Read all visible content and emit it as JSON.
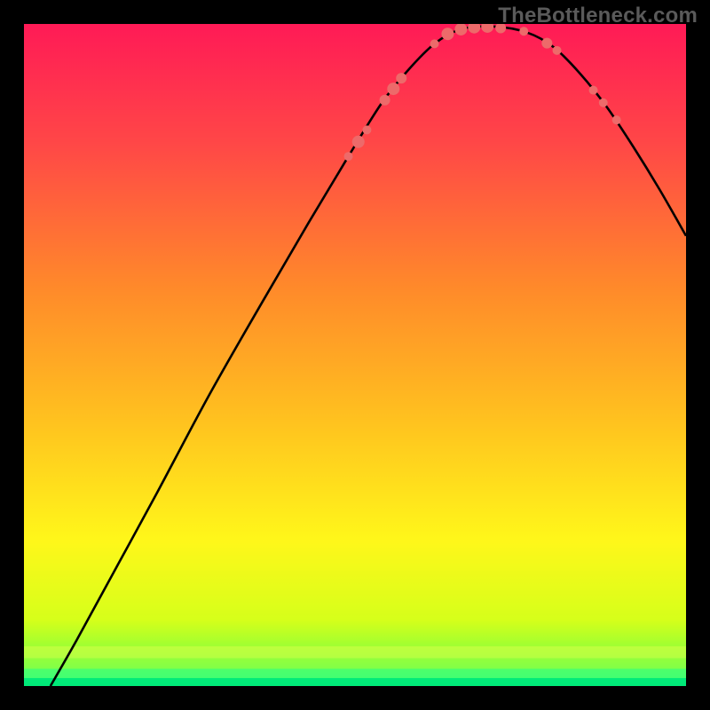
{
  "watermark": "TheBottleneck.com",
  "chart_data": {
    "type": "line",
    "title": "",
    "xlabel": "",
    "ylabel": "",
    "xrange": [
      0,
      100
    ],
    "yrange": [
      0,
      100
    ],
    "gradient_stops": [
      {
        "offset": 0,
        "color": "#ff1a56"
      },
      {
        "offset": 0.18,
        "color": "#ff4747"
      },
      {
        "offset": 0.4,
        "color": "#ff8a2a"
      },
      {
        "offset": 0.6,
        "color": "#ffc21f"
      },
      {
        "offset": 0.78,
        "color": "#fff71a"
      },
      {
        "offset": 0.9,
        "color": "#d6ff1a"
      },
      {
        "offset": 0.955,
        "color": "#8bff3a"
      },
      {
        "offset": 0.985,
        "color": "#2bff7a"
      },
      {
        "offset": 1.0,
        "color": "#00e676"
      }
    ],
    "green_bands": [
      {
        "y": 94.0,
        "color": "#d8ff47",
        "opacity": 0.55,
        "h": 1.8
      },
      {
        "y": 95.8,
        "color": "#9dff3a",
        "opacity": 0.65,
        "h": 1.6
      },
      {
        "y": 97.4,
        "color": "#4cff6e",
        "opacity": 0.8,
        "h": 1.4
      },
      {
        "y": 98.8,
        "color": "#00e978",
        "opacity": 0.95,
        "h": 1.2
      }
    ],
    "curve": [
      {
        "x": 4.0,
        "y": 0.0
      },
      {
        "x": 8.0,
        "y": 7.0
      },
      {
        "x": 14.0,
        "y": 18.0
      },
      {
        "x": 20.0,
        "y": 29.0
      },
      {
        "x": 28.0,
        "y": 44.0
      },
      {
        "x": 36.0,
        "y": 58.0
      },
      {
        "x": 43.0,
        "y": 70.0
      },
      {
        "x": 49.0,
        "y": 80.0
      },
      {
        "x": 54.0,
        "y": 88.0
      },
      {
        "x": 58.0,
        "y": 93.0
      },
      {
        "x": 62.0,
        "y": 97.0
      },
      {
        "x": 66.0,
        "y": 99.2
      },
      {
        "x": 71.0,
        "y": 99.6
      },
      {
        "x": 76.0,
        "y": 98.7
      },
      {
        "x": 80.0,
        "y": 96.5
      },
      {
        "x": 84.0,
        "y": 92.5
      },
      {
        "x": 88.0,
        "y": 87.5
      },
      {
        "x": 92.0,
        "y": 81.5
      },
      {
        "x": 96.0,
        "y": 75.0
      },
      {
        "x": 100.0,
        "y": 68.0
      }
    ],
    "dots": [
      {
        "x": 49.0,
        "y": 80.0,
        "r": 5
      },
      {
        "x": 50.5,
        "y": 82.2,
        "r": 7
      },
      {
        "x": 51.8,
        "y": 84.0,
        "r": 5
      },
      {
        "x": 54.5,
        "y": 88.5,
        "r": 6
      },
      {
        "x": 55.8,
        "y": 90.2,
        "r": 7
      },
      {
        "x": 57.0,
        "y": 91.8,
        "r": 6
      },
      {
        "x": 62.0,
        "y": 97.0,
        "r": 5
      },
      {
        "x": 64.0,
        "y": 98.5,
        "r": 7
      },
      {
        "x": 66.0,
        "y": 99.2,
        "r": 7
      },
      {
        "x": 68.0,
        "y": 99.5,
        "r": 7
      },
      {
        "x": 70.0,
        "y": 99.6,
        "r": 7
      },
      {
        "x": 72.0,
        "y": 99.4,
        "r": 6
      },
      {
        "x": 75.5,
        "y": 98.9,
        "r": 5
      },
      {
        "x": 79.0,
        "y": 97.1,
        "r": 6
      },
      {
        "x": 80.5,
        "y": 96.0,
        "r": 5
      },
      {
        "x": 86.0,
        "y": 90.0,
        "r": 5
      },
      {
        "x": 87.5,
        "y": 88.1,
        "r": 5
      },
      {
        "x": 89.5,
        "y": 85.5,
        "r": 5
      }
    ],
    "dot_color": "#ed6a6a",
    "curve_color": "#000000",
    "curve_width": 2.6
  }
}
